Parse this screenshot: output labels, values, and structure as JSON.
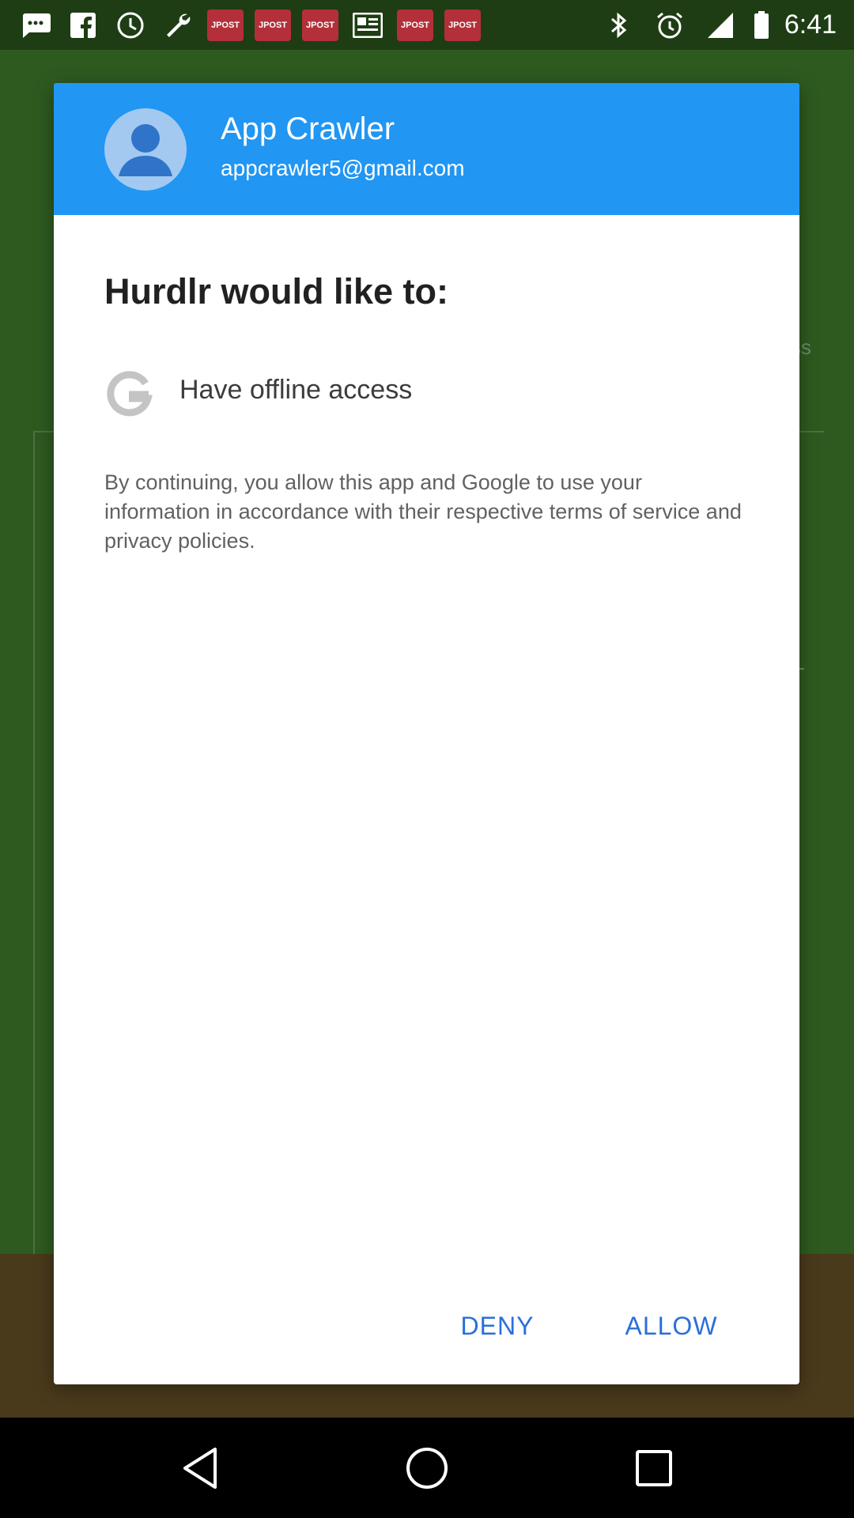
{
  "status_bar": {
    "time": "6:41",
    "jpost_label": "JPOST",
    "icons": [
      "chat-icon",
      "facebook-icon",
      "clock-icon",
      "wrench-icon",
      "jpost-icon",
      "jpost-icon",
      "jpost-icon",
      "news-icon",
      "jpost-icon",
      "jpost-icon",
      "bluetooth-icon",
      "alarm-icon",
      "signal-icon",
      "battery-icon"
    ]
  },
  "dialog": {
    "account": {
      "name": "App Crawler",
      "email": "appcrawler5@gmail.com"
    },
    "title": "Hurdlr would like to:",
    "permissions": [
      {
        "label": "Have offline access",
        "icon": "google-g-icon"
      }
    ],
    "disclaimer": "By continuing, you allow this app and Google to use your information in accordance with their respective terms of service and privacy policies.",
    "buttons": {
      "deny": "DENY",
      "allow": "ALLOW"
    }
  },
  "background": {
    "hint_text": "ss"
  },
  "nav": {
    "back": "back-icon",
    "home": "home-icon",
    "recents": "recents-icon"
  },
  "colors": {
    "header_blue": "#2196f3",
    "button_blue": "#2a6fdb",
    "background_green": "#2e5a1f",
    "jpost_red": "#b3303a"
  }
}
